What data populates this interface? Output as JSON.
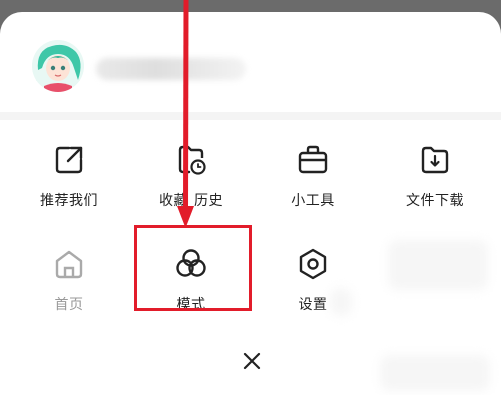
{
  "menu": {
    "items": [
      {
        "label": "推荐我们",
        "icon": "share-icon"
      },
      {
        "label": "收藏",
        "icon": "favorites-history-icon"
      },
      {
        "label": "历史",
        "icon": "favorites-history-icon"
      },
      {
        "label": "小工具",
        "icon": "toolbox-icon"
      },
      {
        "label": "文件下载",
        "icon": "download-folder-icon"
      },
      {
        "label": "首页",
        "icon": "home-icon"
      },
      {
        "label": "模式",
        "icon": "mode-icon"
      },
      {
        "label": "设置",
        "icon": "settings-icon"
      }
    ]
  },
  "colors": {
    "annotation": "#e21c2a",
    "icon_stroke": "#222222",
    "disabled": "#aaaaaa"
  }
}
